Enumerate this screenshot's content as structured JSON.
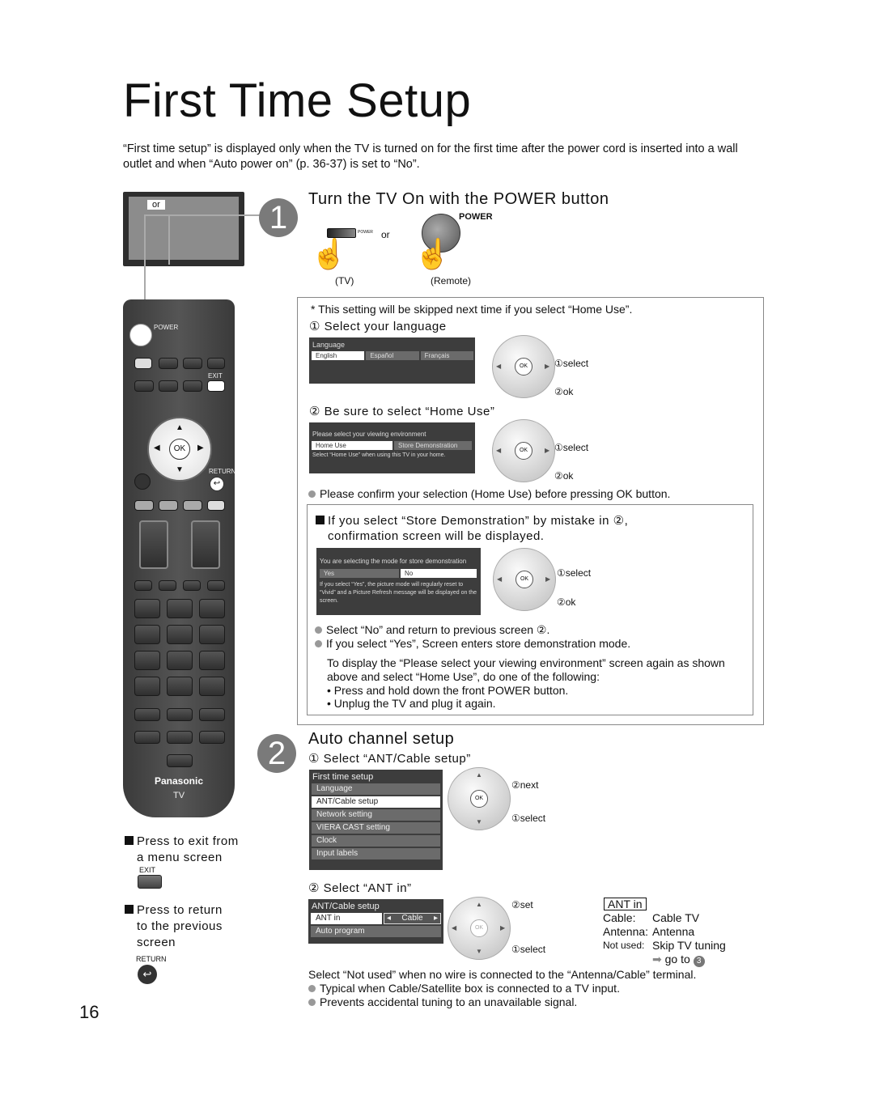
{
  "page": {
    "title": "First Time Setup",
    "intro": "“First time setup” is displayed only when the TV is turned on for the first time after the power cord is inserted into a wall outlet and when “Auto power on” (p. 36-37) is set to “No”.",
    "page_number": "16"
  },
  "tv_illustration": {
    "or_label": "or"
  },
  "remote": {
    "power_label": "POWER",
    "exit_label": "EXIT",
    "ok_label": "OK",
    "return_label": "RETURN",
    "brand": "Panasonic",
    "model_label": "TV"
  },
  "step1": {
    "number": "1",
    "heading": "Turn the TV On with the POWER button",
    "power_label": "POWER",
    "tv_button_label": "POWER",
    "or_label": "or",
    "tv_caption": "(TV)",
    "remote_caption": "(Remote)",
    "note": "* This setting will be skipped next time if you select “Home Use”.",
    "language": {
      "heading": "① Select your language",
      "osd_title": "Language",
      "options": [
        "English",
        "Español",
        "Français"
      ],
      "selected": "English",
      "select_label": "①select",
      "ok_label": "②ok"
    },
    "home_use": {
      "heading": "② Be sure to select “Home Use”",
      "osd_title": "Please select your viewing environment",
      "options": [
        "Home Use",
        "Store Demonstration"
      ],
      "selected": "Home Use",
      "osd_note": "Select “Home Use” when using this TV in your home.",
      "select_label": "①select",
      "ok_label": "②ok",
      "confirm_note": "Please confirm your selection (Home Use) before pressing OK button."
    },
    "store_demo": {
      "heading_line1": "If you select “Store Demonstration” by mistake in ②,",
      "heading_line2": "confirmation screen will be displayed.",
      "osd_title": "You are selecting the mode for store demonstration",
      "options": [
        "Yes",
        "No"
      ],
      "selected": "No",
      "osd_note": "If you select “Yes”, the picture mode will regularly reset to “Vivid” and a Picture Refresh message will be displayed on the screen.",
      "select_label": "①select",
      "ok_label": "②ok",
      "bullets": [
        "Select “No” and return to previous screen ②.",
        "If you select “Yes”, Screen enters store demonstration mode."
      ],
      "para": "To display the “Please select your viewing environment” screen again as shown above and select “Home Use”, do one of the following:",
      "dots": [
        "• Press and hold down the front POWER button.",
        "• Unplug the TV and plug it again."
      ]
    }
  },
  "step2": {
    "number": "2",
    "heading": "Auto channel setup",
    "ant_cable": {
      "heading": "① Select “ANT/Cable setup”",
      "menu_title": "First time setup",
      "items": [
        "Language",
        "ANT/Cable setup",
        "Network setting",
        "VIERA CAST setting",
        "Clock",
        "Input labels"
      ],
      "selected": "ANT/Cable setup",
      "next_label": "②next",
      "select_label": "①select"
    },
    "ant_in": {
      "heading": "② Select “ANT in”",
      "menu_title": "ANT/Cable setup",
      "row_label": "ANT in",
      "row_value": "Cable",
      "item2": "Auto program",
      "set_label": "②set",
      "select_label": "①select",
      "legend_title": "ANT in",
      "legend": [
        {
          "key": "Cable:",
          "value": "Cable TV"
        },
        {
          "key": "Antenna:",
          "value": "Antenna"
        },
        {
          "key": "Not used:",
          "value": "Skip TV tuning"
        }
      ],
      "goto": "go to",
      "goto_step": "3",
      "note": "Select “Not used” when no wire is connected to the “Antenna/Cable” terminal.",
      "bullets": [
        "Typical when Cable/Satellite box is connected to a TV input.",
        "Prevents accidental tuning to an unavailable signal."
      ]
    }
  },
  "sidebar_notes": {
    "exit_note_line1": "Press to exit from",
    "exit_note_line2": "a menu screen",
    "exit_label": "EXIT",
    "return_note_line1": "Press to return",
    "return_note_line2": "to the previous",
    "return_note_line3": "screen",
    "return_label": "RETURN"
  }
}
